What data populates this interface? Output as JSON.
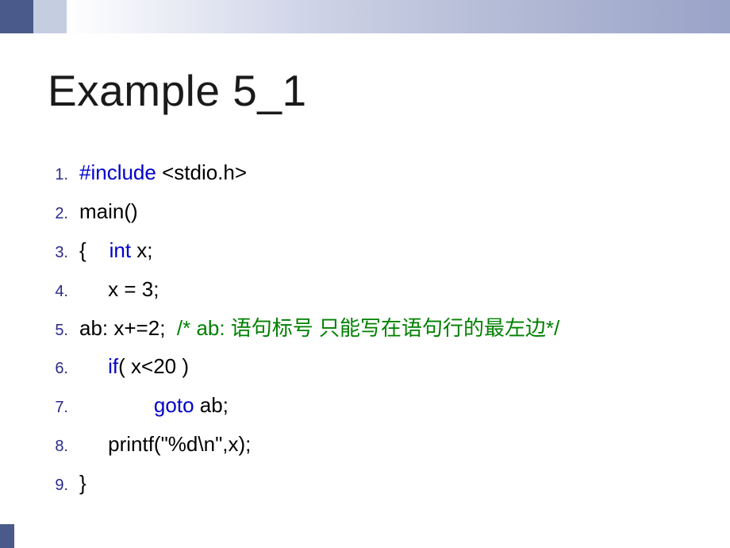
{
  "title": "Example 5_1",
  "lines": [
    {
      "num": "1."
    },
    {
      "num": "2."
    },
    {
      "num": "3."
    },
    {
      "num": "4."
    },
    {
      "num": "5."
    },
    {
      "num": "6."
    },
    {
      "num": "7."
    },
    {
      "num": "8."
    },
    {
      "num": "9."
    }
  ],
  "code": {
    "include_kw": "#include",
    "include_rest": " <stdio.h>",
    "main": "main()",
    "brace_open": "{    ",
    "int_kw": "int",
    "int_rest": " x;",
    "assign": "     x = 3;",
    "label": "ab: x+=2;  ",
    "comment": "/* ab: 语句标号 只能写在语句行的最左边*/",
    "if_indent": "     ",
    "if_kw": "if",
    "if_rest": "( x<20 )",
    "goto_indent": "             ",
    "goto_kw": "goto",
    "goto_rest": " ab;",
    "printf": "     printf(\"%d\\n\",x);",
    "brace_close": "}"
  }
}
